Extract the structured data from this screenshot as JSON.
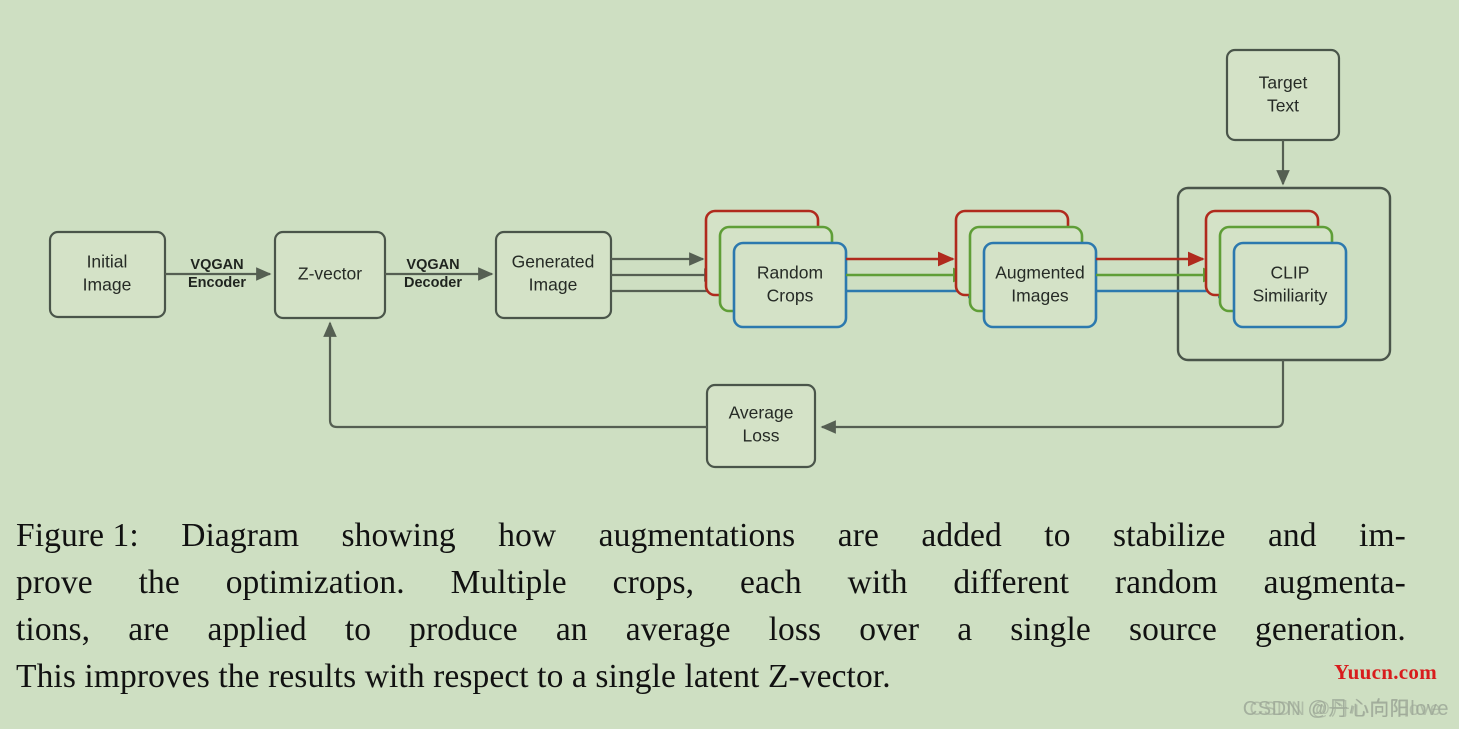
{
  "diagram": {
    "background_color": "#cedfc2",
    "node_fill": "#d4e2c7",
    "node_stroke": "#4a554a",
    "colors": {
      "red": "#b02a1d",
      "green": "#5f9e37",
      "blue": "#2c79ae",
      "gray": "#555f52"
    },
    "nodes": {
      "initial_image": {
        "line1": "Initial",
        "line2": "Image"
      },
      "z_vector": {
        "line1": "Z-vector",
        "line2": ""
      },
      "generated_image": {
        "line1": "Generated",
        "line2": "Image"
      },
      "random_crops": {
        "line1": "Random",
        "line2": "Crops"
      },
      "augmented_images": {
        "line1": "Augmented",
        "line2": "Images"
      },
      "clip_similarity": {
        "line1": "CLIP",
        "line2": "Similiarity"
      },
      "target_text": {
        "line1": "Target",
        "line2": "Text"
      },
      "average_loss": {
        "line1": "Average",
        "line2": "Loss"
      }
    },
    "edge_labels": {
      "encoder": {
        "line1": "VQGAN",
        "line2": "Encoder"
      },
      "decoder": {
        "line1": "VQGAN",
        "line2": "Decoder"
      }
    }
  },
  "caption": {
    "line1": "Figure 1: Diagram showing how augmentations are added to stabilize and im-",
    "line2": "prove the optimization. Multiple crops, each with different random augmenta-",
    "line3": "tions, are applied to produce an average loss over a single source generation.",
    "line4": "This improves the results with respect to a single latent Z-vector.",
    "line1_words": [
      "Figure 1:",
      "Diagram",
      "showing",
      "how",
      "augmentations",
      "are",
      "added",
      "to",
      "stabilize",
      "and",
      "im-"
    ],
    "line2_words": [
      "prove",
      "the",
      "optimization.",
      "Multiple",
      "crops,",
      "each",
      "with",
      "different",
      "random",
      "augmenta-"
    ],
    "line3_words": [
      "tions,",
      "are",
      "applied",
      "to",
      "produce",
      "an",
      "average",
      "loss",
      "over",
      "a",
      "single",
      "source",
      "generation."
    ]
  },
  "watermarks": {
    "yuucn": "Yuucn.com",
    "csdn": "CSDN @丹心向阳love",
    "csdn_overlay": "CSDN @丹心向阳ove"
  }
}
